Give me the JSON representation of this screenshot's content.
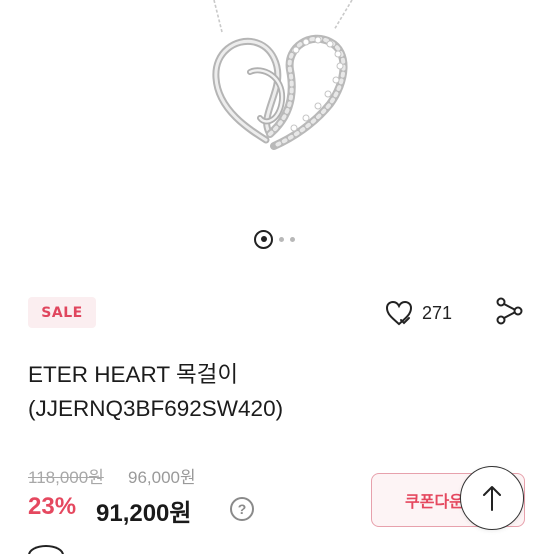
{
  "gallery": {
    "image_label": "heart-necklace-product-image",
    "active_index": 1,
    "total": 3
  },
  "badge": {
    "label": "SALE"
  },
  "like": {
    "count": "271",
    "icon": "heart-icon"
  },
  "share": {
    "icon": "share-icon"
  },
  "product": {
    "title_line1": "ETER HEART 목걸이",
    "title_line2": "(JJERNQ3BF692SW420)"
  },
  "pricing": {
    "original_price": "118,000원",
    "list_price": "96,000원",
    "discount": "23%",
    "final_price": "91,200원",
    "help_label": "?"
  },
  "coupon": {
    "label": "쿠폰다운"
  },
  "colors": {
    "accent": "#e5485f",
    "badge_bg": "#fbeef0",
    "muted": "#a8a8a8"
  }
}
